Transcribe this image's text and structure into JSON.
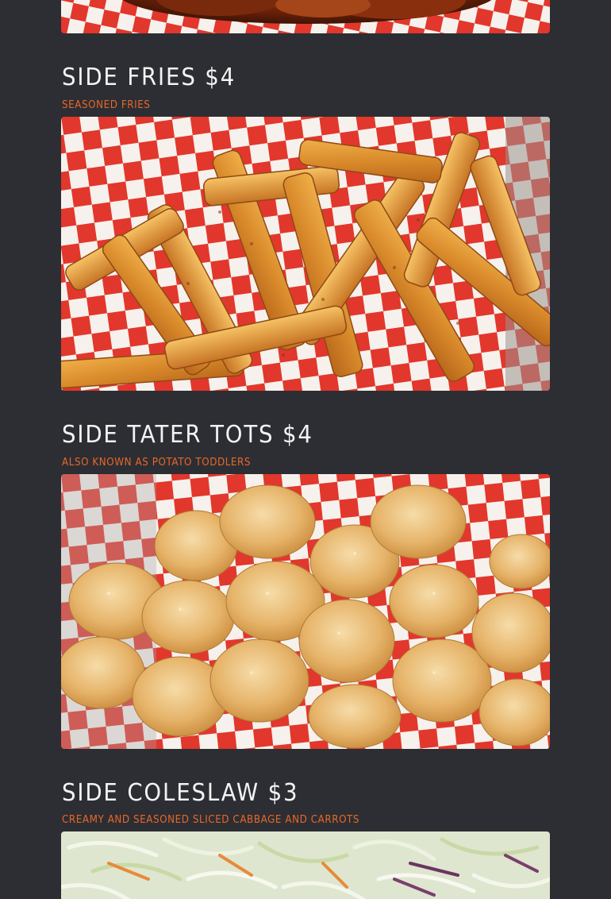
{
  "colors": {
    "background": "#2c2e33",
    "title": "#f3f3f3",
    "description": "#e8672a",
    "checker_red": "#e2372c",
    "checker_white": "#f6f1ec"
  },
  "menu": {
    "items": [
      {
        "title": "SIDE FRIES $4",
        "description": "SEASONED FRIES",
        "photo_icon": "fries-photo"
      },
      {
        "title": "SIDE TATER TOTS $4",
        "description": "ALSO KNOWN AS POTATO TODDLERS",
        "photo_icon": "tater-tots-photo"
      },
      {
        "title": "SIDE COLESLAW $3",
        "description": "CREAMY AND SEASONED SLICED CABBAGE AND CARROTS",
        "photo_icon": "coleslaw-photo"
      }
    ],
    "previous_item_photo_icon": "wings-photo"
  }
}
